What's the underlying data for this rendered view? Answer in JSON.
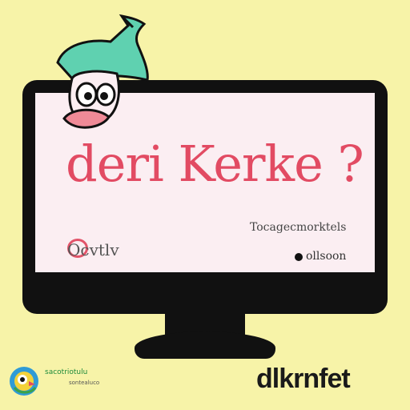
{
  "screen": {
    "headline": "deri Kerke ?",
    "right_line": "Tocagecmorktels",
    "right_line_2": "ollsoon",
    "left_mark": "Ocvtlv"
  },
  "footer": {
    "brand": "dlkrnfet",
    "small_text": "sacotriotulu",
    "small_text_2": "sontealuco"
  },
  "icons": {
    "mascot": "cartoon-duck-mascot-with-hat",
    "bottom_logo": "colorful-bird-logo"
  },
  "colors": {
    "background": "#f7f3a8",
    "monitor": "#111111",
    "screen": "#fbeef2",
    "accent_pink": "#e24b63",
    "hat_teal": "#5fd1b0"
  }
}
